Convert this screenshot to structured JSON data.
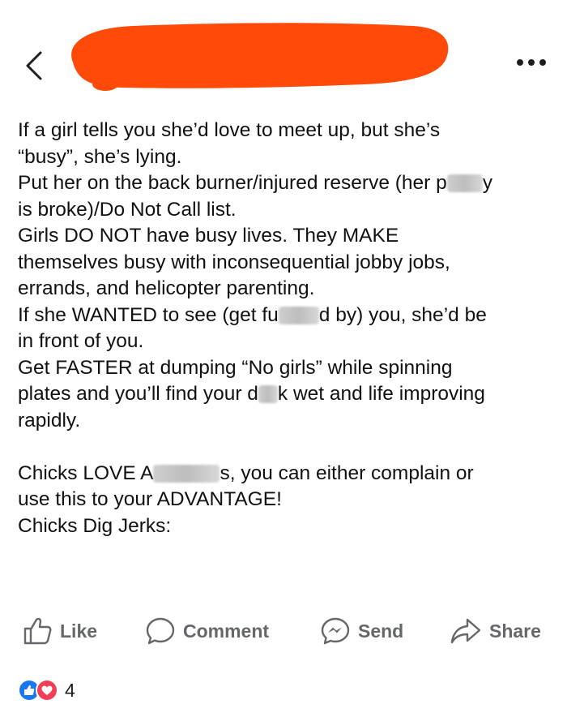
{
  "post": {
    "lines": [
      "If a girl tells you she’d love to meet up, but she’s",
      "“busy”, she’s lying.",
      "Put her on the back burner/injured reserve (her p",
      "y",
      "is broke)/Do Not Call list.",
      "Girls DO NOT have busy lives. They MAKE",
      "themselves busy with inconsequential jobby jobs,",
      "errands, and helicopter parenting.",
      "If she WANTED to see (get fu",
      "d by) you, she’d be",
      "in front of you.",
      "Get FASTER at dumping “No girls” while spinning",
      "plates and you’ll find your d",
      "k wet and life improving",
      "rapidly.",
      "Chicks LOVE A",
      "s, you can either complain or",
      "use this to your ADVANTAGE!",
      "Chicks Dig Jerks:"
    ]
  },
  "actions": {
    "like": "Like",
    "comment": "Comment",
    "send": "Send",
    "share": "Share"
  },
  "reactions": {
    "count": "4",
    "types": [
      "like-icon",
      "love-icon"
    ]
  },
  "colors": {
    "redaction": "#ff4a0a",
    "action_gray": "#65676b",
    "like_blue": "#1877f2",
    "love_red": "#f33e58"
  }
}
